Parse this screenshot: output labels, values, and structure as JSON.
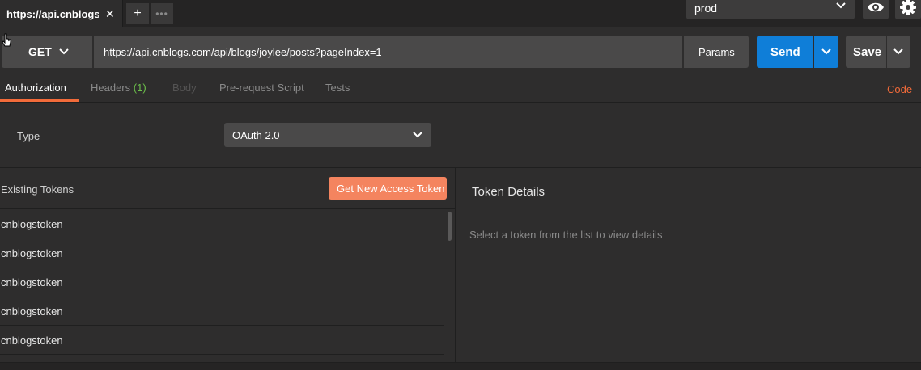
{
  "tabs": {
    "active_title": "https://api.cnblogs.c",
    "close_glyph": "✕",
    "plus_glyph": "+",
    "more_glyph": "•••"
  },
  "environment": {
    "selected": "prod"
  },
  "request": {
    "method": "GET",
    "url": "https://api.cnblogs.com/api/blogs/joylee/posts?pageIndex=1",
    "params_label": "Params",
    "send_label": "Send",
    "save_label": "Save"
  },
  "request_tabs": {
    "authorization": "Authorization",
    "headers": "Headers",
    "headers_count": "(1)",
    "body": "Body",
    "prerequest": "Pre-request Script",
    "tests": "Tests",
    "code": "Code"
  },
  "auth": {
    "type_label": "Type",
    "type_value": "OAuth 2.0"
  },
  "tokens": {
    "existing_label": "Existing Tokens",
    "get_new_label": "Get New Access Token",
    "items": [
      "cnblogstoken",
      "cnblogstoken",
      "cnblogstoken",
      "cnblogstoken",
      "cnblogstoken"
    ]
  },
  "details": {
    "title": "Token Details",
    "hint": "Select a token from the list to view details"
  },
  "colors": {
    "accent_orange": "#f26b3a",
    "send_blue": "#0f7ed8",
    "count_green": "#6cc04a"
  },
  "icons": [
    "close-icon",
    "plus-icon",
    "more-icon",
    "chevron-down-icon",
    "eye-icon",
    "gear-icon",
    "cursor-icon"
  ]
}
